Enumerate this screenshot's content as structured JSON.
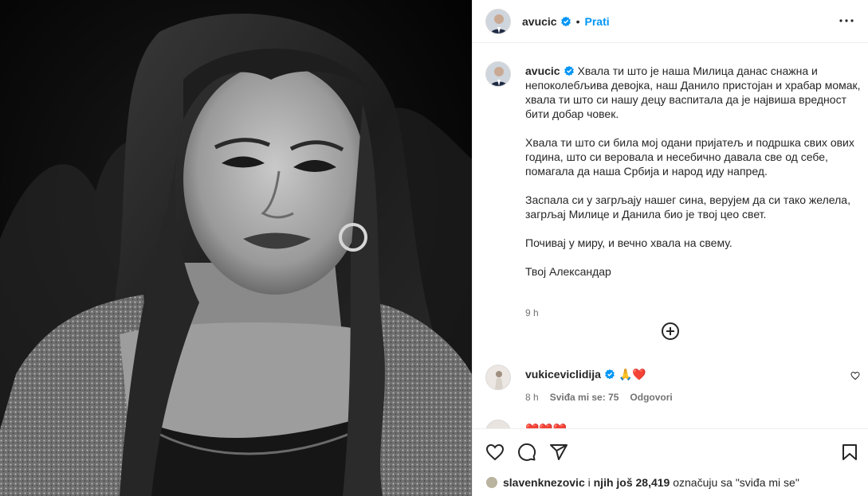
{
  "post": {
    "author": "avucic",
    "follow_label": "Prati",
    "separator": "•",
    "caption": "Хвала ти што је наша Милица данас снажна и непоколебљива девојка, наш Данило пристојан и храбар момак, хвала ти што си нашу децу васпитала да је највиша вредност бити добар човек.\n\nХвала ти што си била мој одани пријатељ и подршка свих ових година, што си веровала и несебично давала све од себе, помагала да наша Србија и народ иду напред.\n\nЗаспала си у загрљају нашег сина, верујем да си тако желела, загрљај Милице и Данила био је твој цео свет.\n\nПочивај у миру, и вечно хвала на свему.\n\nТвој Александар",
    "time": "9 h"
  },
  "comments": [
    {
      "user": "vukiceviclidija",
      "text": "🙏❤️",
      "time": "8 h",
      "likes": "Sviđa mi se: 75",
      "reply": "Odgovori"
    },
    {
      "text": "❤️❤️❤️"
    }
  ],
  "likes_line": {
    "user": "slavenknezovic",
    "middle": " i ",
    "others": "njih još 28,419",
    "suffix": " označuju sa \"sviđa mi se\""
  },
  "icons": {
    "verified": "verified-badge-icon",
    "more": "more-options-icon",
    "add": "add-circle-icon",
    "like": "heart-icon",
    "comment": "comment-icon",
    "share": "share-icon",
    "save": "bookmark-icon"
  },
  "colors": {
    "accent": "#0095f6",
    "verified": "#0095f6",
    "heart": "#ed4956"
  }
}
